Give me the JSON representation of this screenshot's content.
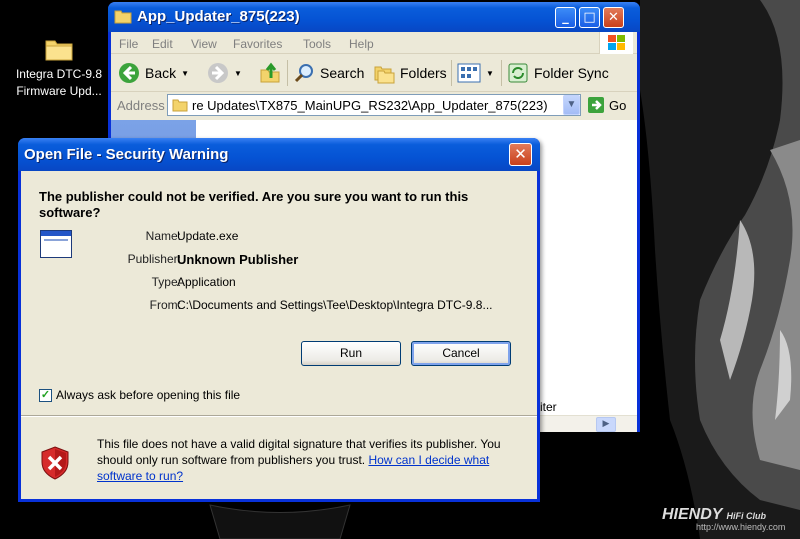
{
  "desktop": {
    "icon_label": "Integra DTC-9.8\nFirmware Upd..."
  },
  "watermark": {
    "brand": "HIENDY",
    "club": "HiFi Club",
    "url": "http://www.hiendy.com"
  },
  "explorer": {
    "title": "App_Updater_875(223)",
    "menu": [
      "File",
      "Edit",
      "View",
      "Favorites",
      "Tools",
      "Help"
    ],
    "toolbar": {
      "back": "Back",
      "search": "Search",
      "folders": "Folders",
      "folder_sync": "Folder Sync"
    },
    "address_label": "Address",
    "address_value": "re Updates\\TX875_MainUPG_RS232\\App_Updater_875(223)",
    "go_label": "Go",
    "peek_text": "iter"
  },
  "dialog": {
    "title": "Open File - Security Warning",
    "question": "The publisher could not be verified.  Are you sure you want to run this software?",
    "props": {
      "name_label": "Name:",
      "name_value": "Update.exe",
      "publisher_label": "Publisher:",
      "publisher_value": "Unknown Publisher",
      "type_label": "Type:",
      "type_value": "Application",
      "from_label": "From:",
      "from_value": "C:\\Documents and Settings\\Tee\\Desktop\\Integra DTC-9.8..."
    },
    "run_label": "Run",
    "cancel_label": "Cancel",
    "checkbox_label": "Always ask before opening this file",
    "checkbox_checked": true,
    "warning_text": "This file does not have a valid digital signature that verifies its publisher.  You should only run software from publishers you trust.  ",
    "warning_link": "How can I decide what software to run?"
  },
  "colors": {
    "titlebar_blue": "#0553d4",
    "dialog_face": "#ece9d8",
    "link_blue": "#0033cc",
    "close_red": "#c9401b"
  }
}
